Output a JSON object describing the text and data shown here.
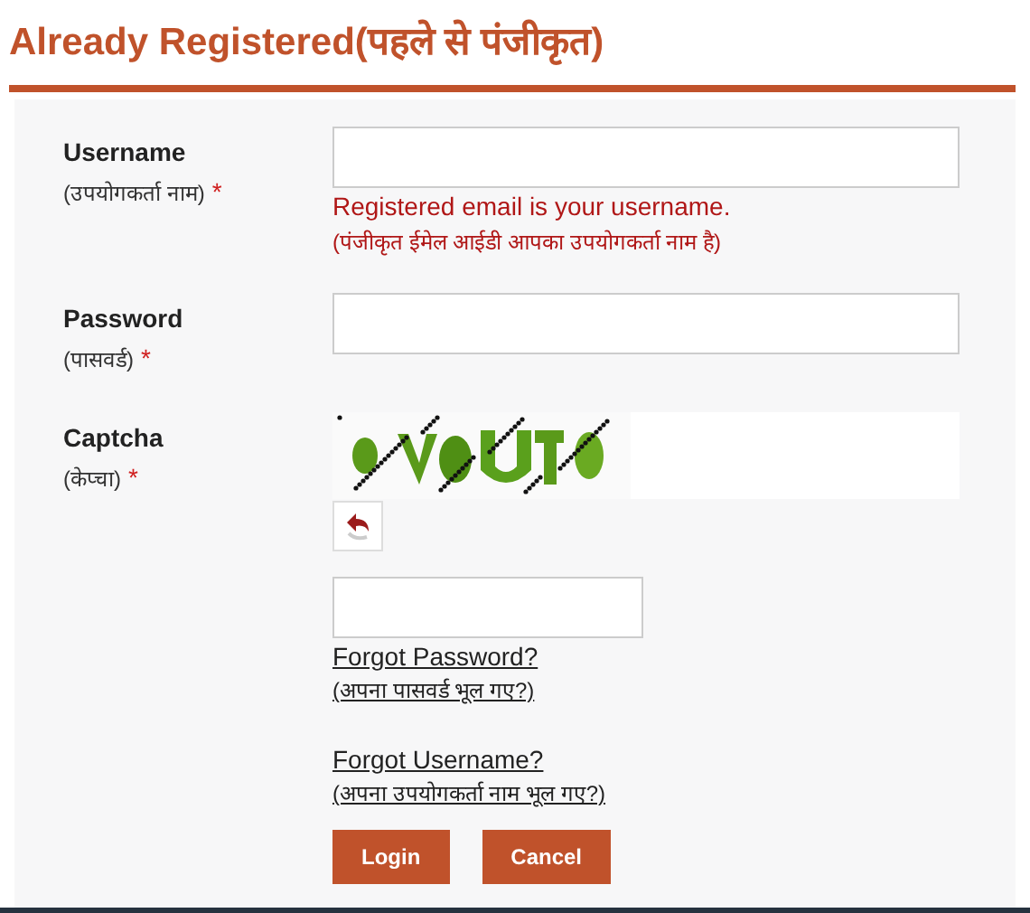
{
  "heading": "Already Registered(पहले से पंजीकृत)",
  "fields": [
    {
      "kind": "text",
      "label": "Username",
      "sublabel": "(उपयोगकर्ता नाम)",
      "required_mark": "*",
      "hint": "Registered email is your username.",
      "hint_translation": "(पंजीकृत ईमेल आईडी आपका उपयोगकर्ता नाम है)"
    },
    {
      "kind": "password",
      "label": "Password",
      "sublabel": "(पासवर्ड)",
      "required_mark": "*"
    },
    {
      "kind": "captcha",
      "label": "Captcha",
      "sublabel": "(केप्चा)",
      "required_mark": "*"
    }
  ],
  "links": [
    {
      "text": "Forgot Password?",
      "translation": "(अपना पासवर्ड भूल गए?)"
    },
    {
      "text": "Forgot Username?",
      "translation": "(अपना उपयोगकर्ता नाम भूल गए?)"
    }
  ],
  "buttons": [
    "Login",
    "Cancel"
  ]
}
